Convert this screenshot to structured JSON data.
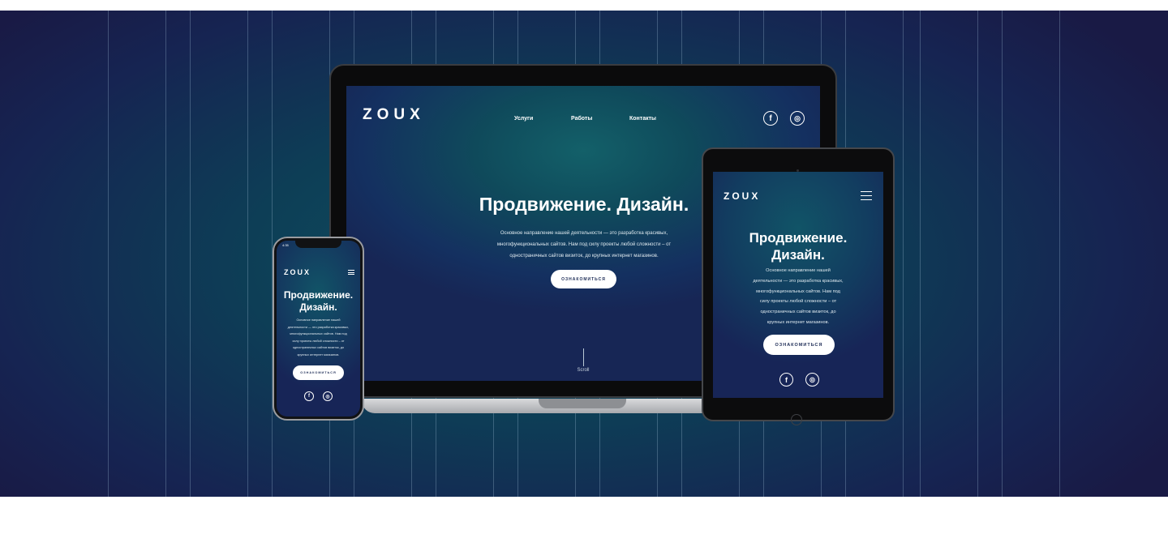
{
  "brand": {
    "logo": "ZOUX"
  },
  "nav": {
    "items": [
      "Услуги",
      "Работы",
      "Контакты"
    ]
  },
  "social": {
    "facebook_glyph": "f",
    "instagram_glyph": "◎"
  },
  "hero": {
    "title": "Продвижение. Дизайн.",
    "title_line1": "Продвижение.",
    "title_line2": "Дизайн.",
    "desktop_description": [
      "Основное направление нашей деятельности — это разработка красивых,",
      "многофункциональных сайтов. Нам под силу проекты любой сложности – от",
      "одностраничных сайтов визиток, до крупных интернет магазинов."
    ],
    "tablet_description": [
      "Основное направление нашей",
      "деятельности — это разработка красивых,",
      "многофункциональных сайтов. Нам под",
      "силу проекты любой сложности – от",
      "одностраничных сайтов визиток, до",
      "крупных интернет магазинов."
    ],
    "phone_description": [
      "Основное направление нашей",
      "деятельности — это разработка красивых,",
      "многофункциональных сайтов. Нам под",
      "силу проекты любой сложности – от",
      "одностраничных сайтов визиток, до",
      "крупных интернет магазинов."
    ],
    "cta_label": "ОЗНАКОМИТЬСЯ",
    "scroll_label": "Scroll"
  },
  "phone_status": {
    "time": "4:35"
  },
  "colors": {
    "background": "#0d3e56",
    "cta_text": "#1c2b55",
    "cta_bg": "#ffffff"
  }
}
